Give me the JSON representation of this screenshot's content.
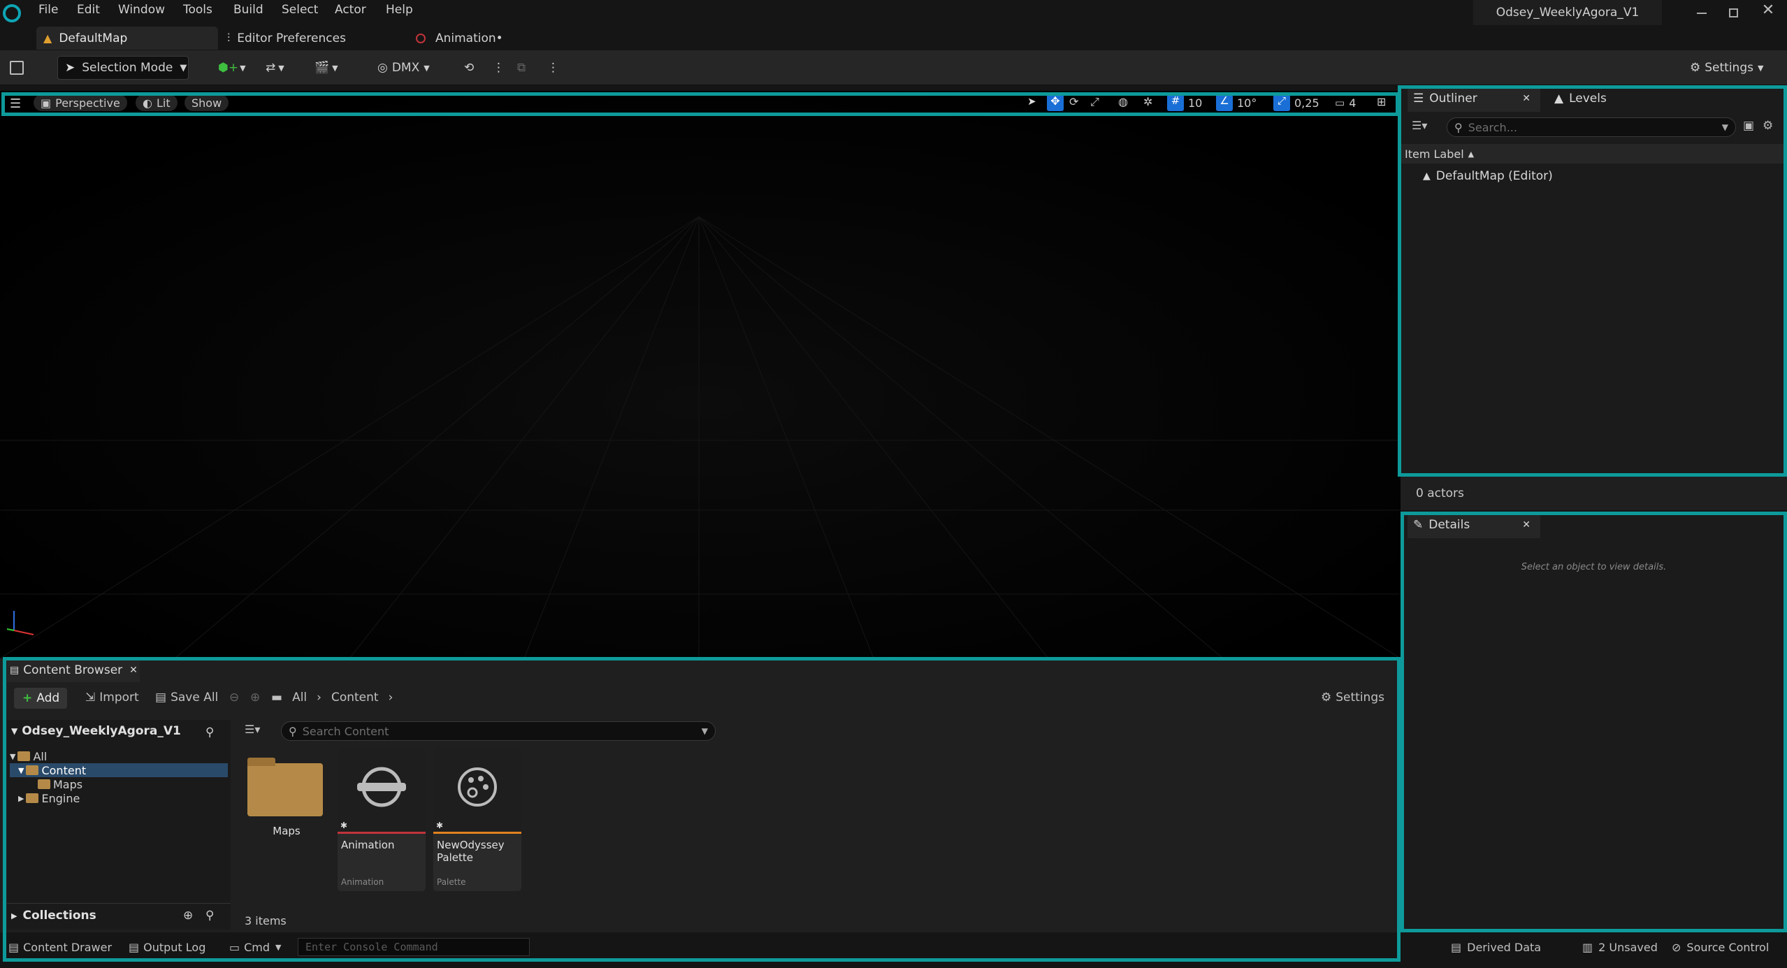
{
  "app": {
    "project_title": "Odsey_WeeklyAgora_V1"
  },
  "menu": {
    "items": [
      "File",
      "Edit",
      "Window",
      "Tools",
      "Build",
      "Select",
      "Actor",
      "Help"
    ]
  },
  "tabs": [
    {
      "label": "DefaultMap",
      "icon": "level-icon",
      "active": true
    },
    {
      "label": "Editor Preferences",
      "icon": "sliders-icon"
    },
    {
      "label": "Animation•",
      "icon": "animation-icon"
    }
  ],
  "toolbar": {
    "selection_mode": "Selection Mode",
    "dmx": "DMX",
    "settings": "Settings"
  },
  "viewport": {
    "perspective": "Perspective",
    "lit": "Lit",
    "show": "Show",
    "grid_snap": "10",
    "rotation_snap": "10°",
    "scale_snap": "0,25",
    "camera_speed": "4"
  },
  "outliner": {
    "tab_label": "Outliner",
    "levels_tab": "Levels",
    "search_placeholder": "Search...",
    "column_header": "Item Label",
    "items": [
      "DefaultMap (Editor)"
    ],
    "actor_count": "0 actors"
  },
  "details": {
    "tab_label": "Details",
    "empty_message": "Select an object to view details."
  },
  "content_browser": {
    "tab_label": "Content Browser",
    "add": "Add",
    "import": "Import",
    "save_all": "Save All",
    "breadcrumb": [
      "All",
      "Content"
    ],
    "settings": "Settings",
    "project_root": "Odsey_WeeklyAgora_V1",
    "search_placeholder": "Search Content",
    "tree": [
      {
        "label": "All",
        "depth": 0
      },
      {
        "label": "Content",
        "depth": 1,
        "selected": true
      },
      {
        "label": "Maps",
        "depth": 2
      },
      {
        "label": "Engine",
        "depth": 1
      }
    ],
    "collections": "Collections",
    "assets": [
      {
        "name": "Maps",
        "type": "",
        "kind": "folder"
      },
      {
        "name": "Animation",
        "type": "Animation",
        "kind": "asset",
        "accent": "#c0343a"
      },
      {
        "name": "NewOdyssey Palette",
        "type": "Palette",
        "kind": "asset",
        "accent": "#e0821e"
      }
    ],
    "item_count": "3 items"
  },
  "statusbar": {
    "content_drawer": "Content Drawer",
    "output_log": "Output Log",
    "cmd": "Cmd",
    "console_placeholder": "Enter Console Command",
    "derived_data": "Derived Data",
    "unsaved": "2 Unsaved",
    "source_control": "Source Control"
  },
  "colors": {
    "highlight": "#0e9a9a",
    "accent_blue": "#1a6fd6",
    "folder": "#b58a48"
  }
}
